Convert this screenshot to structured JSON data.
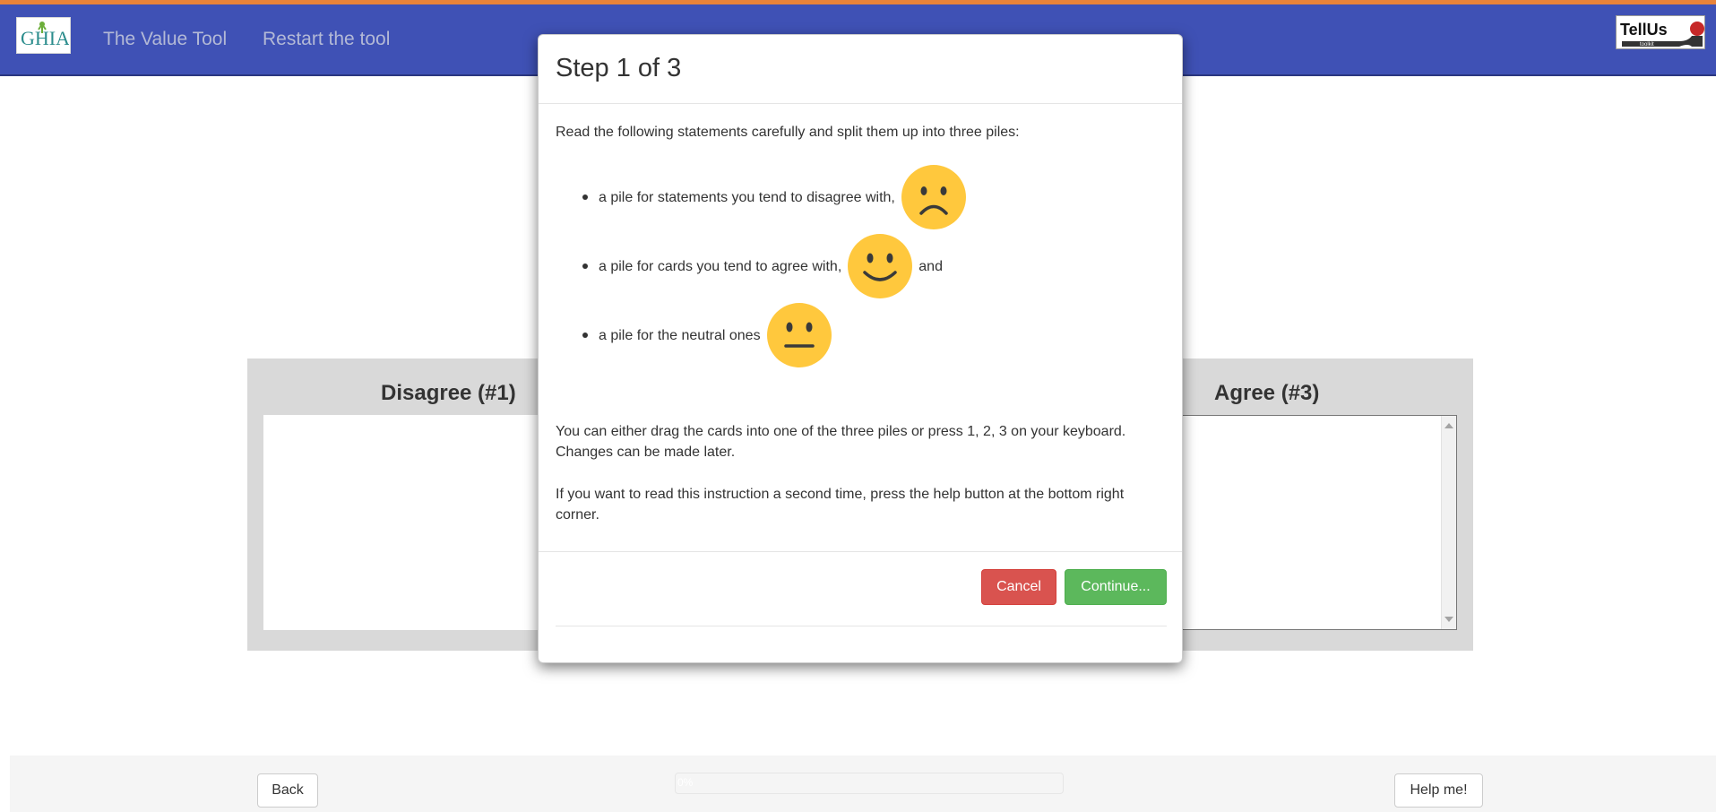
{
  "navbar": {
    "brand_logo_text": "GHIA",
    "links": [
      "The Value Tool",
      "Restart the tool"
    ],
    "partner_logo_text": "TellUs",
    "partner_logo_subtext": "toolkit"
  },
  "piles": {
    "disagree_title": "Disagree (#1)",
    "agree_title": "Agree (#3)"
  },
  "footer": {
    "back_label": "Back",
    "progress_label": "0%",
    "progress_value": 0,
    "help_label": "Help me!"
  },
  "modal": {
    "title": "Step 1 of 3",
    "intro": "Read the following statements carefully and split them up into three piles:",
    "bullets": [
      {
        "text": "a pile for statements you tend to disagree with,",
        "icon": "sad-face-icon",
        "suffix": ""
      },
      {
        "text": "a pile for cards you tend to agree with,",
        "icon": "happy-face-icon",
        "suffix": "and"
      },
      {
        "text": "a pile for the neutral ones",
        "icon": "neutral-face-icon",
        "suffix": ""
      }
    ],
    "drag_instruction": "You can either drag the cards into one of the three piles or press 1, 2, 3 on your keyboard. Changes can be made later.",
    "help_instruction": "If you want to read this instruction a second time, press the help button at the bottom right corner.",
    "cancel_label": "Cancel",
    "continue_label": "Continue..."
  },
  "colors": {
    "navbar": "#3f51b5",
    "accent_strip": "#e8833a",
    "cancel": "#d9534f",
    "continue": "#5cb85c",
    "emoji_face": "#ffc83d"
  }
}
